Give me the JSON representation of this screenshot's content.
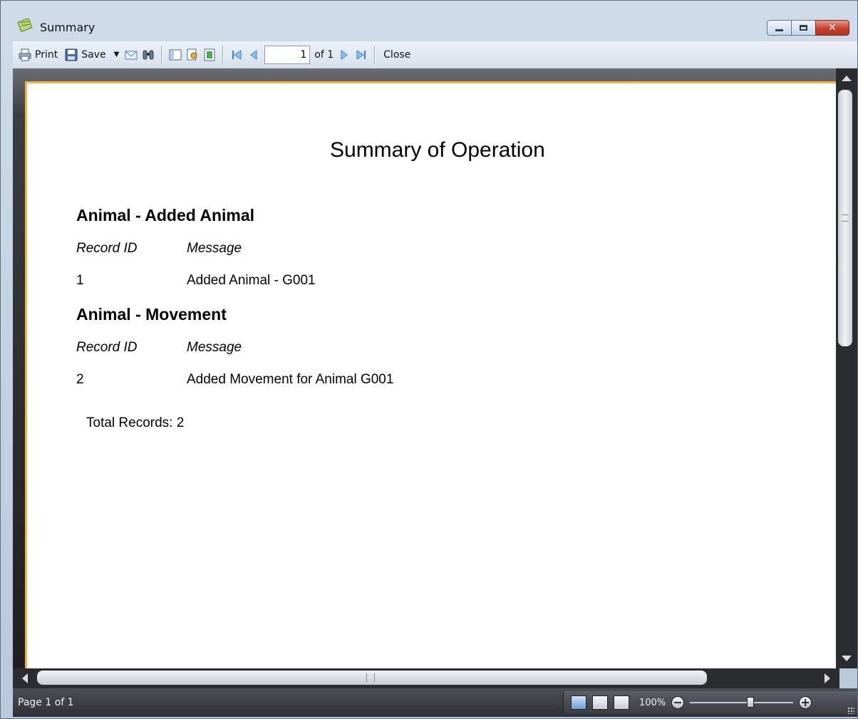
{
  "window": {
    "title": "Summary"
  },
  "toolbar": {
    "print_label": "Print",
    "save_label": "Save",
    "page_value": "1",
    "page_of": "of 1",
    "close_label": "Close"
  },
  "report": {
    "title": "Summary of Operation",
    "sections": [
      {
        "title": "Animal - Added Animal",
        "col_record": "Record ID",
        "col_message": "Message",
        "rows": [
          {
            "id": "1",
            "message": "Added Animal - G001"
          }
        ]
      },
      {
        "title": "Animal - Movement",
        "col_record": "Record ID",
        "col_message": "Message",
        "rows": [
          {
            "id": "2",
            "message": "Added Movement for Animal G001"
          }
        ]
      }
    ],
    "total": "Total Records: 2"
  },
  "status": {
    "page": "Page 1 of 1",
    "zoom": "100%"
  },
  "colors": {
    "accent": "#f3b23c",
    "viewer_bg": "#1e1f22"
  }
}
